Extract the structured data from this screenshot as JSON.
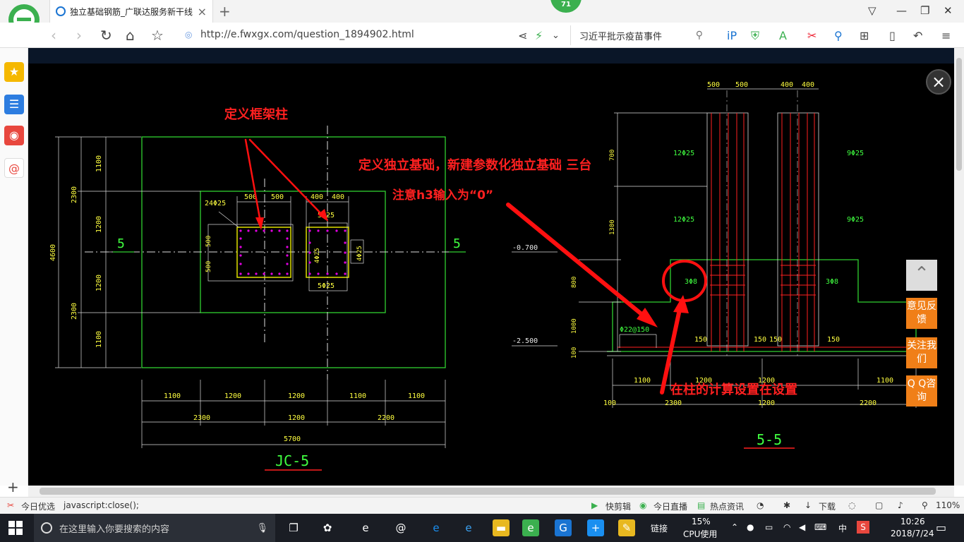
{
  "browser": {
    "tab_title": "独立基础钢筋_广联达服务新干线",
    "badge": "71",
    "url": "http://e.fwxgx.com/question_1894902.html",
    "search_text": "习近平批示疫苗事件"
  },
  "drawing": {
    "annotations": {
      "define_column": "定义框架柱",
      "define_foundation": "定义独立基础，新建参数化独立基础 三台",
      "h3_note": "注意h3输入为“0”",
      "column_calc": "在柱的计算设置在设置"
    },
    "plan": {
      "title": "JC-5",
      "section_mark": "5",
      "left_dims": [
        "2300",
        "1100",
        "1200",
        "1200",
        "2300",
        "1100",
        "4600"
      ],
      "top_dims": [
        "500",
        "500",
        "400",
        "400"
      ],
      "bottom_dims_row1": [
        "1100",
        "1200",
        "1200",
        "1100",
        "1100"
      ],
      "bottom_dims_row2": [
        "2300",
        "1200",
        "2200"
      ],
      "total": "5700",
      "rebar": [
        "24Φ25",
        "5Φ25",
        "5Φ25",
        "4Φ25",
        "4Φ25"
      ],
      "small_dims": [
        "500",
        "500"
      ]
    },
    "section": {
      "title": "5-5",
      "top_dims": [
        "500",
        "500",
        "400",
        "400"
      ],
      "levels": [
        "-0.700",
        "-2.500"
      ],
      "left_dims": [
        "700",
        "1300",
        "800",
        "1000",
        "100"
      ],
      "rebar": [
        "12Φ25",
        "12Φ25",
        "9Φ25",
        "9Φ25",
        "3Φ8",
        "3Φ8",
        "Φ22@150"
      ],
      "bottom_dims_row1": [
        "1100",
        "1200",
        "1200",
        "1100"
      ],
      "bottom_dims_row2": [
        "100",
        "2300",
        "1200",
        "2200"
      ],
      "small_150": [
        "150",
        "150",
        "150",
        "150"
      ]
    }
  },
  "side_buttons": {
    "feedback": "意见反馈",
    "follow": "关注我们",
    "qq": "Q Q咨询"
  },
  "statusbar": {
    "left": "今日优选",
    "js": "javascript:close();",
    "kuaijian": "快剪辑",
    "live": "今日直播",
    "hot": "热点资讯",
    "download": "下载",
    "zoom": "110%"
  },
  "taskbar": {
    "search_placeholder": "在这里输入你要搜索的内容",
    "link": "链接",
    "cpu_pct": "15%",
    "cpu_label": "CPU使用",
    "ime": "中",
    "time": "10:26",
    "date": "2018/7/24"
  },
  "colors": {
    "cad_background": "#000000",
    "accent_orange": "#f07f18",
    "annotation_red": "#ff1010"
  }
}
